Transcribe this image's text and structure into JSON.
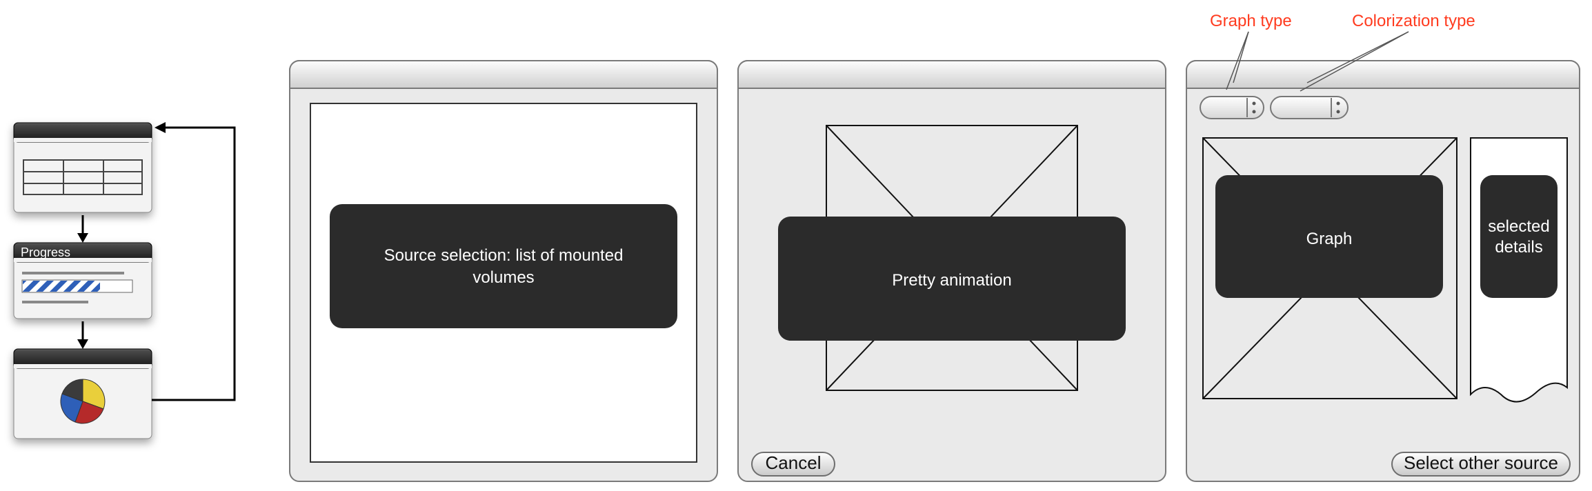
{
  "annotations": {
    "graph_type": "Graph type",
    "colorization_type": "Colorization type"
  },
  "flow": {
    "progress_label": "Progress"
  },
  "panels": {
    "source": {
      "sticky": "Source selection: list of mounted volumes"
    },
    "animation": {
      "sticky": "Pretty animation",
      "cancel": "Cancel"
    },
    "graph": {
      "graph_sticky": "Graph",
      "details_sticky": "selected details",
      "select_other": "Select other source"
    }
  }
}
